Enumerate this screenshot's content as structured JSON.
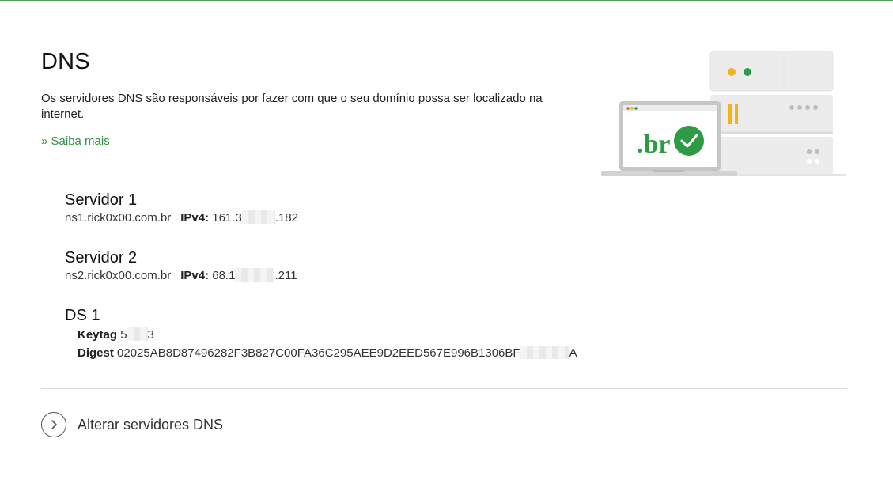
{
  "section": {
    "title": "DNS",
    "description": "Os servidores DNS são responsáveis por fazer com que o seu domínio possa ser localizado na internet.",
    "more_link": "» Saiba mais"
  },
  "servers": [
    {
      "title": "Servidor 1",
      "host": "ns1.rick0x00.com.br",
      "ip_label": "IPv4:",
      "ip_start": "161.3",
      "ip_end": ".182"
    },
    {
      "title": "Servidor 2",
      "host": "ns2.rick0x00.com.br",
      "ip_label": "IPv4:",
      "ip_start": "68.1",
      "ip_end": ".211"
    }
  ],
  "ds": {
    "title": "DS 1",
    "keytag_label": "Keytag",
    "keytag_start": "5",
    "keytag_end": "3",
    "digest_label": "Digest",
    "digest_start": "02025AB8D87496282F3B827C00FA36C295AEE9D2EED567E996B1306BF",
    "digest_end": "A"
  },
  "actions": {
    "change_dns": "Alterar servidores DNS"
  },
  "illustration": {
    "logo_text": ".br",
    "accent_green": "#2f9a45",
    "accent_yellow": "#f2b319"
  }
}
